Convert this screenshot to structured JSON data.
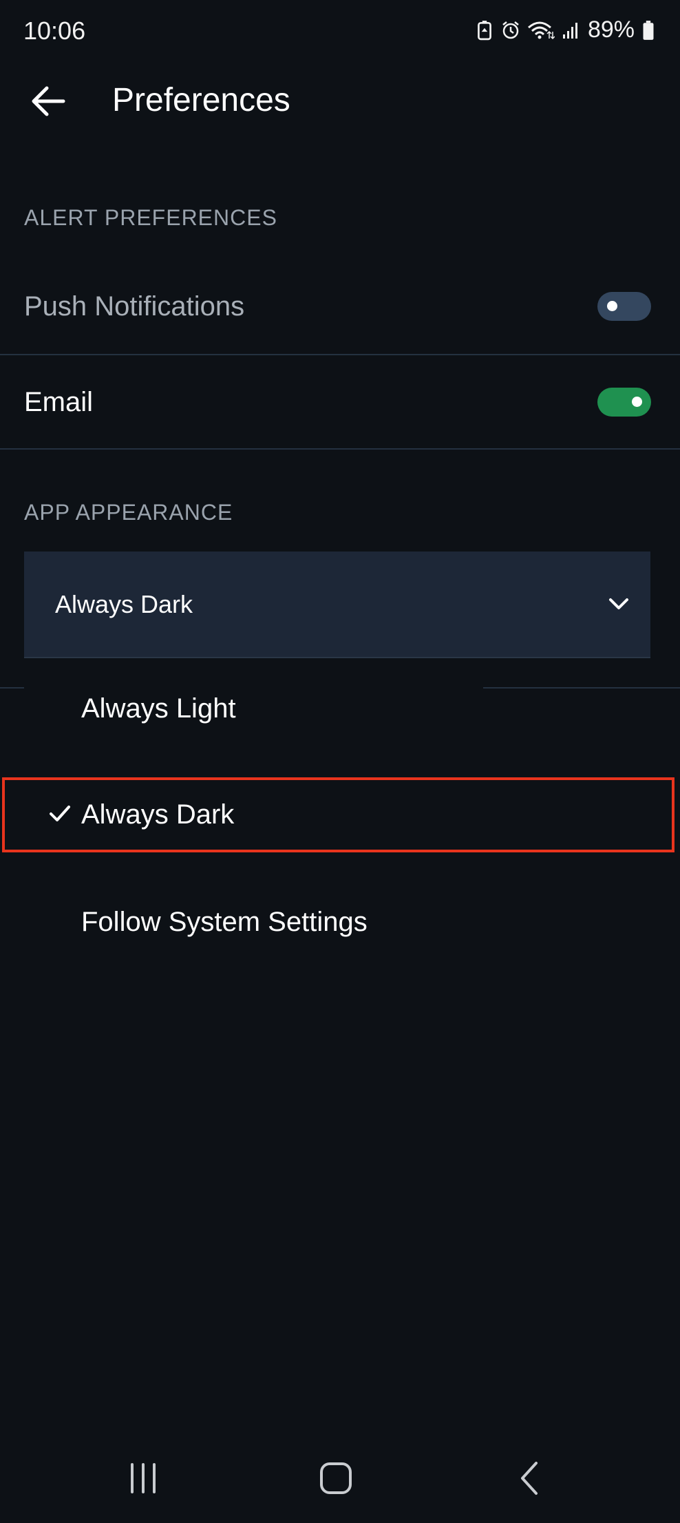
{
  "status_bar": {
    "time": "10:06",
    "battery_percent": "89%",
    "icons": [
      "battery-saver-icon",
      "alarm-icon",
      "wifi-icon",
      "signal-icon",
      "battery-icon"
    ]
  },
  "header": {
    "back_icon": "arrow-left-icon",
    "title": "Preferences"
  },
  "alert_preferences": {
    "section_title": "ALERT PREFERENCES",
    "items": [
      {
        "label": "Push Notifications",
        "enabled": false
      },
      {
        "label": "Email",
        "enabled": true
      }
    ]
  },
  "app_appearance": {
    "section_title": "APP APPEARANCE",
    "selected": "Always Dark",
    "options": [
      {
        "label": "Always Light",
        "selected": false
      },
      {
        "label": "Always Dark",
        "selected": true
      },
      {
        "label": "Follow System Settings",
        "selected": false
      }
    ]
  },
  "colors": {
    "background": "#0d1116",
    "dropdown_bg": "#1d2737",
    "toggle_off": "#34475f",
    "toggle_on": "#1f9150",
    "section_text": "#9aa3ad",
    "highlight": "#e8341d"
  },
  "nav_bar": {
    "icons": [
      "recent-apps-icon",
      "home-icon",
      "back-nav-icon"
    ]
  }
}
